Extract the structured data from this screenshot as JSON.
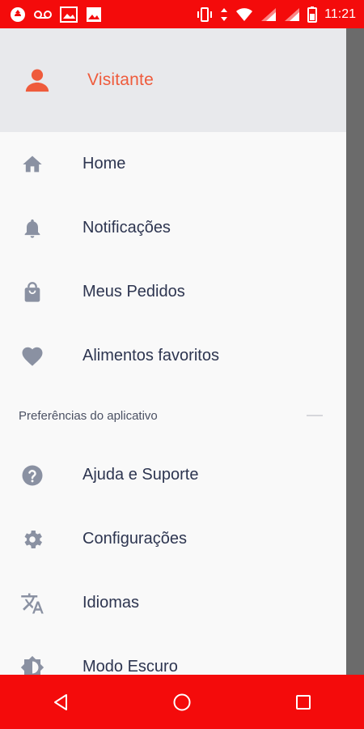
{
  "status_bar": {
    "time": "11:21",
    "icons": [
      "opera-icon",
      "voicemail-icon",
      "gallery-icon",
      "image-icon",
      "vibrate-icon",
      "data-arrows-icon",
      "wifi-icon",
      "signal-icon",
      "signal-icon",
      "battery-icon"
    ]
  },
  "drawer": {
    "header": {
      "user_name": "Visitante",
      "icon": "person-icon",
      "accent": "#ef5b3c"
    },
    "items": [
      {
        "label": "Home",
        "icon": "home-icon"
      },
      {
        "label": "Notificações",
        "icon": "bell-icon"
      },
      {
        "label": "Meus Pedidos",
        "icon": "shopping-bag-icon"
      },
      {
        "label": "Alimentos favoritos",
        "icon": "heart-icon"
      }
    ],
    "section": {
      "label": "Preferências do aplicativo"
    },
    "preference_items": [
      {
        "label": "Ajuda e Suporte",
        "icon": "help-icon"
      },
      {
        "label": "Configurações",
        "icon": "settings-icon"
      },
      {
        "label": "Idiomas",
        "icon": "translate-icon"
      },
      {
        "label": "Modo Escuro",
        "icon": "brightness-icon"
      }
    ]
  },
  "nav_bar": {
    "buttons": [
      "back-icon",
      "home-circle-icon",
      "recents-icon"
    ],
    "color": "#f40b0b"
  }
}
